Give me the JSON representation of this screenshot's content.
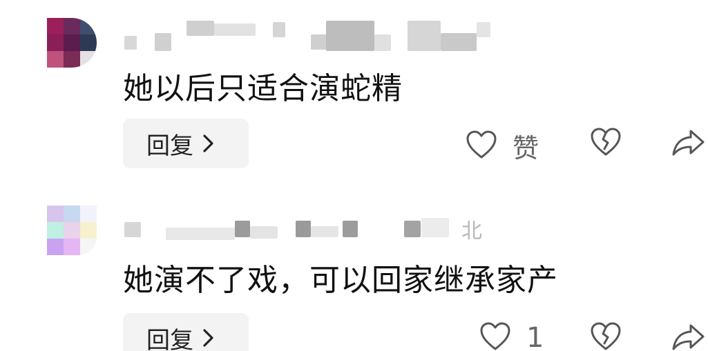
{
  "comments": [
    {
      "text": "她以后只适合演蛇精",
      "reply_label": "回复",
      "like_label": "赞",
      "colors": {
        "avatar": [
          "#9b1f5b",
          "#6a2a5c",
          "#3f4f6e",
          "#8a1e56",
          "#5b1d4e",
          "#2e3a55",
          "#c0517c",
          "#7c2a58",
          "#e6e0e4"
        ]
      }
    },
    {
      "text": "她演不了戏，可以回家继承家产",
      "reply_label": "回复",
      "like_count": "1",
      "location": "北",
      "colors": {
        "avatar": [
          "#d7c5ee",
          "#c7d9f0",
          "#f2f2fb",
          "#bff0e3",
          "#e9d2ea",
          "#f7f1cf",
          "#c9a3f0",
          "#e4b6f4",
          "#f5f5f5"
        ]
      }
    }
  ],
  "icons": {
    "like": "heart-outline-icon",
    "dislike": "broken-heart-icon",
    "share": "share-arrow-icon",
    "chevron": "chevron-right-icon"
  }
}
